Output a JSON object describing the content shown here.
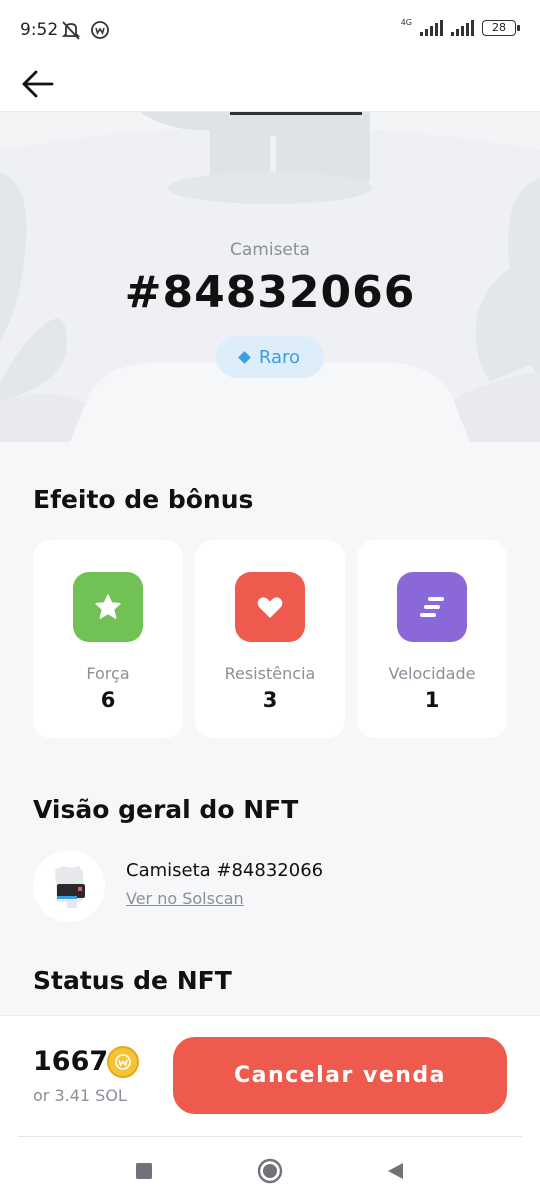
{
  "status_bar": {
    "time": "9:52",
    "network": "4G",
    "battery": "28"
  },
  "header": {
    "back_icon": "arrow-left-icon"
  },
  "hero": {
    "item_type": "Camiseta",
    "item_id": "#84832066",
    "rarity": "Raro",
    "rarity_color": "#3a9fe3"
  },
  "bonus": {
    "title": "Efeito de bônus",
    "stats": [
      {
        "label": "Força",
        "value": "6",
        "icon": "star-icon",
        "color": "#72c155"
      },
      {
        "label": "Resistência",
        "value": "3",
        "icon": "heart-icon",
        "color": "#ee5a4e"
      },
      {
        "label": "Velocidade",
        "value": "1",
        "icon": "speed-lines-icon",
        "color": "#8b68d8"
      }
    ]
  },
  "overview": {
    "title": "Visão geral do NFT",
    "nft_name": "Camiseta #84832066",
    "link": "Ver no Solscan"
  },
  "status": {
    "title": "Status de NFT"
  },
  "footer": {
    "price": "1667",
    "price_sol": "or 3.41 SOL",
    "cancel_label": "Cancelar venda",
    "accent": "#ee5a4e"
  }
}
